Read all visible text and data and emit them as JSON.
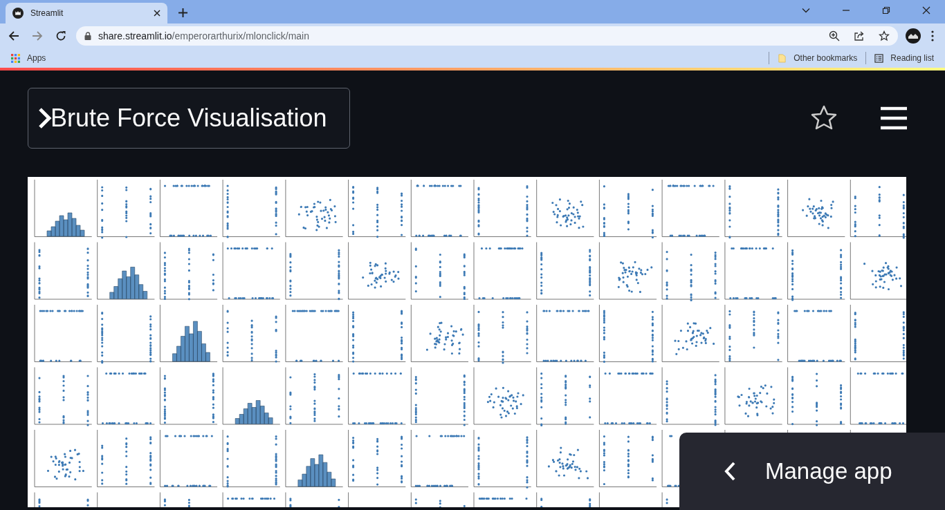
{
  "browser": {
    "tabs": [
      {
        "title": "Streamlit",
        "selected": true
      }
    ],
    "url": {
      "host": "share.streamlit.io",
      "path": "/emperorarthurix/mlonclick/main"
    },
    "bookmarks": [
      {
        "label": "Apps",
        "kind": "apps"
      }
    ],
    "bookmarks_right": [
      {
        "label": "Other bookmarks",
        "kind": "folder"
      },
      {
        "label": "Reading list",
        "kind": "list"
      }
    ]
  },
  "app": {
    "title": "Brute Force Visualisation",
    "manage_app": {
      "label": "Manage app"
    }
  }
}
